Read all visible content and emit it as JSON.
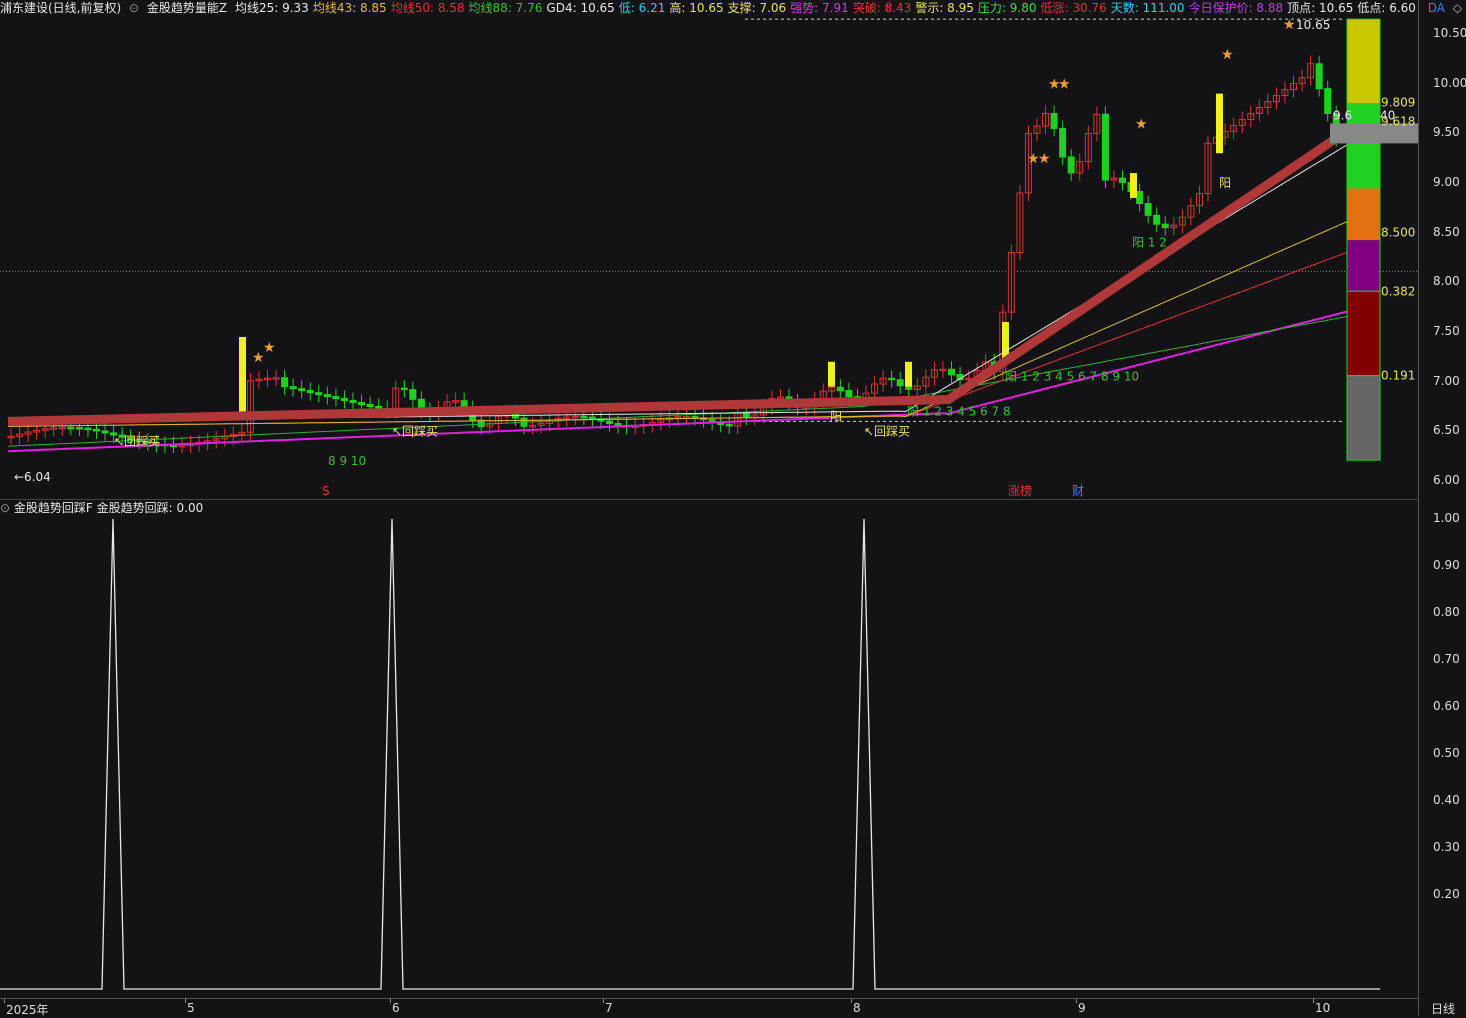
{
  "header": {
    "stock": "浦东建设(日线,前复权)",
    "indicator": "金股趋势量能Z",
    "fields": [
      {
        "label": "均线25:",
        "value": "9.33",
        "color": "#e8e8e8"
      },
      {
        "label": "均线43:",
        "value": "8.85",
        "color": "#e0c020"
      },
      {
        "label": "均线50:",
        "value": "8.58",
        "color": "#e03030"
      },
      {
        "label": "均线88:",
        "value": "7.76",
        "color": "#30c030"
      },
      {
        "label": "GD4:",
        "value": "10.65",
        "color": "#e8e8e8"
      },
      {
        "label": "低:",
        "value": "6.21",
        "color": "#30c8e8"
      },
      {
        "label": "高:",
        "value": "10.65",
        "color": "#e8e060"
      },
      {
        "label": "支撑:",
        "value": "7.06",
        "color": "#e8e060"
      },
      {
        "label": "强势:",
        "value": "7.91",
        "color": "#e030e0"
      },
      {
        "label": "突破:",
        "value": "8.43",
        "color": "#e03030"
      },
      {
        "label": "警示:",
        "value": "8.95",
        "color": "#e8e060"
      },
      {
        "label": "压力:",
        "value": "9.80",
        "color": "#30e030"
      },
      {
        "label": "低涨:",
        "value": "30.76",
        "color": "#e03030"
      },
      {
        "label": "天数:",
        "value": "111.00",
        "color": "#30c8e8"
      },
      {
        "label": "今日保护价:",
        "value": "8.88",
        "color": "#b040e0"
      },
      {
        "label": "顶点:",
        "value": "10.65",
        "color": "#e8e8e8"
      },
      {
        "label": "低点:",
        "value": "6.60",
        "color": "#e8e8e8"
      }
    ],
    "tail": "DA"
  },
  "price_axis": [
    "10.50",
    "10.00",
    "9.50",
    "9.00",
    "8.50",
    "8.00",
    "7.50",
    "7.00",
    "6.50",
    "6.00"
  ],
  "indicator_bar": {
    "name": "金股趋势回踩F",
    "value_label": "金股趋势回踩:",
    "value": "0.00"
  },
  "ind_axis": [
    "1.00",
    "0.90",
    "0.80",
    "0.70",
    "0.60",
    "0.50",
    "0.40",
    "0.30",
    "0.20"
  ],
  "time_axis": [
    "2025年",
    "5",
    "6",
    "7",
    "8",
    "9",
    "10"
  ],
  "period_label": "日线",
  "annotations": {
    "low_mark": "←6.04",
    "high_mark": "10.65",
    "buy1": "↖回踩买",
    "buy2": "↖回踩买",
    "buy3": "↖回踩买",
    "seq1": "8 9 10",
    "seq2": "阳 1 2 3 4 5 6 7 8 9 10",
    "seq3": "阳 1 2 3 4 5 6 7 8",
    "seq4": "阳 1 2",
    "yang1": "阳",
    "yang2": "阳",
    "fib": [
      "9.809",
      "9.618",
      "8.500",
      "0.382",
      "0.191"
    ],
    "fib_small": [
      "9.6",
      "40"
    ],
    "tag_s": "S",
    "tag_zt": "涨榜",
    "tag_cai": "财"
  },
  "colors": {
    "up": "#e03030",
    "down": "#20d020",
    "bg": "#131316",
    "magenta": "#e020e0"
  }
}
